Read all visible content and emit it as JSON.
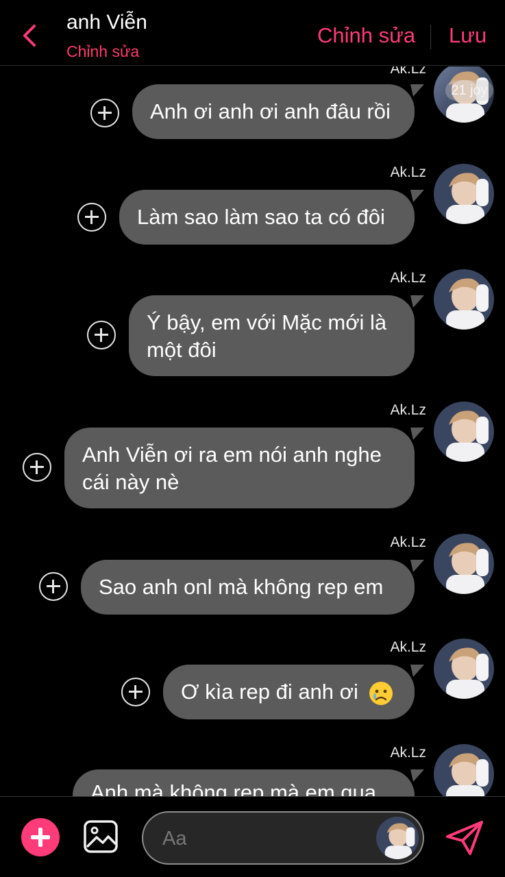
{
  "header": {
    "title": "anh Viễn",
    "subtitle": "Chỉnh sửa",
    "edit_label": "Chỉnh sửa",
    "save_label": "Lưu"
  },
  "messages": [
    {
      "sender": "Ak.Lz",
      "text": "Anh ơi anh ơi anh đâu rồi",
      "badge": "21 joy"
    },
    {
      "sender": "Ak.Lz",
      "text": "Làm sao làm sao ta có đôi"
    },
    {
      "sender": "Ak.Lz",
      "line1": "Ý bậy, em với Mặc mới là",
      "line2": "một đôi"
    },
    {
      "sender": "Ak.Lz",
      "line1": "Anh Viễn ơi ra em nói anh nghe",
      "line2": "cái này nè"
    },
    {
      "sender": "Ak.Lz",
      "text": "Sao anh onl mà không rep em"
    },
    {
      "sender": "Ak.Lz",
      "text": "Ơ kìa rep đi anh ơi",
      "emoji": "crying-face"
    },
    {
      "sender": "Ak.Lz",
      "text": "Anh mà không rep mà em qua"
    }
  ],
  "composer": {
    "placeholder": "Aa"
  },
  "icons": {
    "back": "chevron-left-icon",
    "add": "plus-icon",
    "gallery": "image-icon",
    "send": "paper-plane-icon",
    "react": "add-reaction-icon"
  },
  "colors": {
    "accent": "#ff3b7a",
    "subtitle": "#ff3b6b",
    "bubble": "#5b5b5c",
    "background": "#000000"
  }
}
